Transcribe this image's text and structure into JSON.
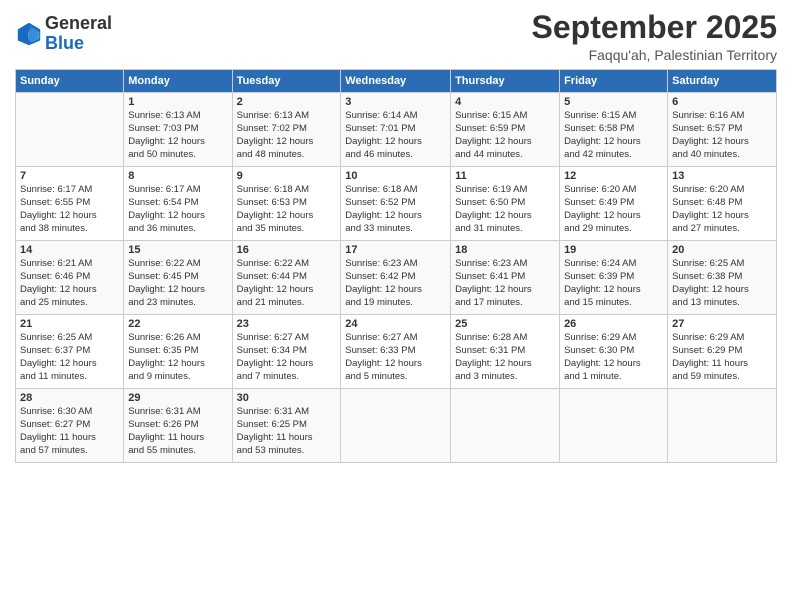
{
  "header": {
    "logo_line1": "General",
    "logo_line2": "Blue",
    "month": "September 2025",
    "location": "Faqqu'ah, Palestinian Territory"
  },
  "weekdays": [
    "Sunday",
    "Monday",
    "Tuesday",
    "Wednesday",
    "Thursday",
    "Friday",
    "Saturday"
  ],
  "weeks": [
    [
      {
        "day": "",
        "info": ""
      },
      {
        "day": "1",
        "info": "Sunrise: 6:13 AM\nSunset: 7:03 PM\nDaylight: 12 hours\nand 50 minutes."
      },
      {
        "day": "2",
        "info": "Sunrise: 6:13 AM\nSunset: 7:02 PM\nDaylight: 12 hours\nand 48 minutes."
      },
      {
        "day": "3",
        "info": "Sunrise: 6:14 AM\nSunset: 7:01 PM\nDaylight: 12 hours\nand 46 minutes."
      },
      {
        "day": "4",
        "info": "Sunrise: 6:15 AM\nSunset: 6:59 PM\nDaylight: 12 hours\nand 44 minutes."
      },
      {
        "day": "5",
        "info": "Sunrise: 6:15 AM\nSunset: 6:58 PM\nDaylight: 12 hours\nand 42 minutes."
      },
      {
        "day": "6",
        "info": "Sunrise: 6:16 AM\nSunset: 6:57 PM\nDaylight: 12 hours\nand 40 minutes."
      }
    ],
    [
      {
        "day": "7",
        "info": "Sunrise: 6:17 AM\nSunset: 6:55 PM\nDaylight: 12 hours\nand 38 minutes."
      },
      {
        "day": "8",
        "info": "Sunrise: 6:17 AM\nSunset: 6:54 PM\nDaylight: 12 hours\nand 36 minutes."
      },
      {
        "day": "9",
        "info": "Sunrise: 6:18 AM\nSunset: 6:53 PM\nDaylight: 12 hours\nand 35 minutes."
      },
      {
        "day": "10",
        "info": "Sunrise: 6:18 AM\nSunset: 6:52 PM\nDaylight: 12 hours\nand 33 minutes."
      },
      {
        "day": "11",
        "info": "Sunrise: 6:19 AM\nSunset: 6:50 PM\nDaylight: 12 hours\nand 31 minutes."
      },
      {
        "day": "12",
        "info": "Sunrise: 6:20 AM\nSunset: 6:49 PM\nDaylight: 12 hours\nand 29 minutes."
      },
      {
        "day": "13",
        "info": "Sunrise: 6:20 AM\nSunset: 6:48 PM\nDaylight: 12 hours\nand 27 minutes."
      }
    ],
    [
      {
        "day": "14",
        "info": "Sunrise: 6:21 AM\nSunset: 6:46 PM\nDaylight: 12 hours\nand 25 minutes."
      },
      {
        "day": "15",
        "info": "Sunrise: 6:22 AM\nSunset: 6:45 PM\nDaylight: 12 hours\nand 23 minutes."
      },
      {
        "day": "16",
        "info": "Sunrise: 6:22 AM\nSunset: 6:44 PM\nDaylight: 12 hours\nand 21 minutes."
      },
      {
        "day": "17",
        "info": "Sunrise: 6:23 AM\nSunset: 6:42 PM\nDaylight: 12 hours\nand 19 minutes."
      },
      {
        "day": "18",
        "info": "Sunrise: 6:23 AM\nSunset: 6:41 PM\nDaylight: 12 hours\nand 17 minutes."
      },
      {
        "day": "19",
        "info": "Sunrise: 6:24 AM\nSunset: 6:39 PM\nDaylight: 12 hours\nand 15 minutes."
      },
      {
        "day": "20",
        "info": "Sunrise: 6:25 AM\nSunset: 6:38 PM\nDaylight: 12 hours\nand 13 minutes."
      }
    ],
    [
      {
        "day": "21",
        "info": "Sunrise: 6:25 AM\nSunset: 6:37 PM\nDaylight: 12 hours\nand 11 minutes."
      },
      {
        "day": "22",
        "info": "Sunrise: 6:26 AM\nSunset: 6:35 PM\nDaylight: 12 hours\nand 9 minutes."
      },
      {
        "day": "23",
        "info": "Sunrise: 6:27 AM\nSunset: 6:34 PM\nDaylight: 12 hours\nand 7 minutes."
      },
      {
        "day": "24",
        "info": "Sunrise: 6:27 AM\nSunset: 6:33 PM\nDaylight: 12 hours\nand 5 minutes."
      },
      {
        "day": "25",
        "info": "Sunrise: 6:28 AM\nSunset: 6:31 PM\nDaylight: 12 hours\nand 3 minutes."
      },
      {
        "day": "26",
        "info": "Sunrise: 6:29 AM\nSunset: 6:30 PM\nDaylight: 12 hours\nand 1 minute."
      },
      {
        "day": "27",
        "info": "Sunrise: 6:29 AM\nSunset: 6:29 PM\nDaylight: 11 hours\nand 59 minutes."
      }
    ],
    [
      {
        "day": "28",
        "info": "Sunrise: 6:30 AM\nSunset: 6:27 PM\nDaylight: 11 hours\nand 57 minutes."
      },
      {
        "day": "29",
        "info": "Sunrise: 6:31 AM\nSunset: 6:26 PM\nDaylight: 11 hours\nand 55 minutes."
      },
      {
        "day": "30",
        "info": "Sunrise: 6:31 AM\nSunset: 6:25 PM\nDaylight: 11 hours\nand 53 minutes."
      },
      {
        "day": "",
        "info": ""
      },
      {
        "day": "",
        "info": ""
      },
      {
        "day": "",
        "info": ""
      },
      {
        "day": "",
        "info": ""
      }
    ]
  ]
}
